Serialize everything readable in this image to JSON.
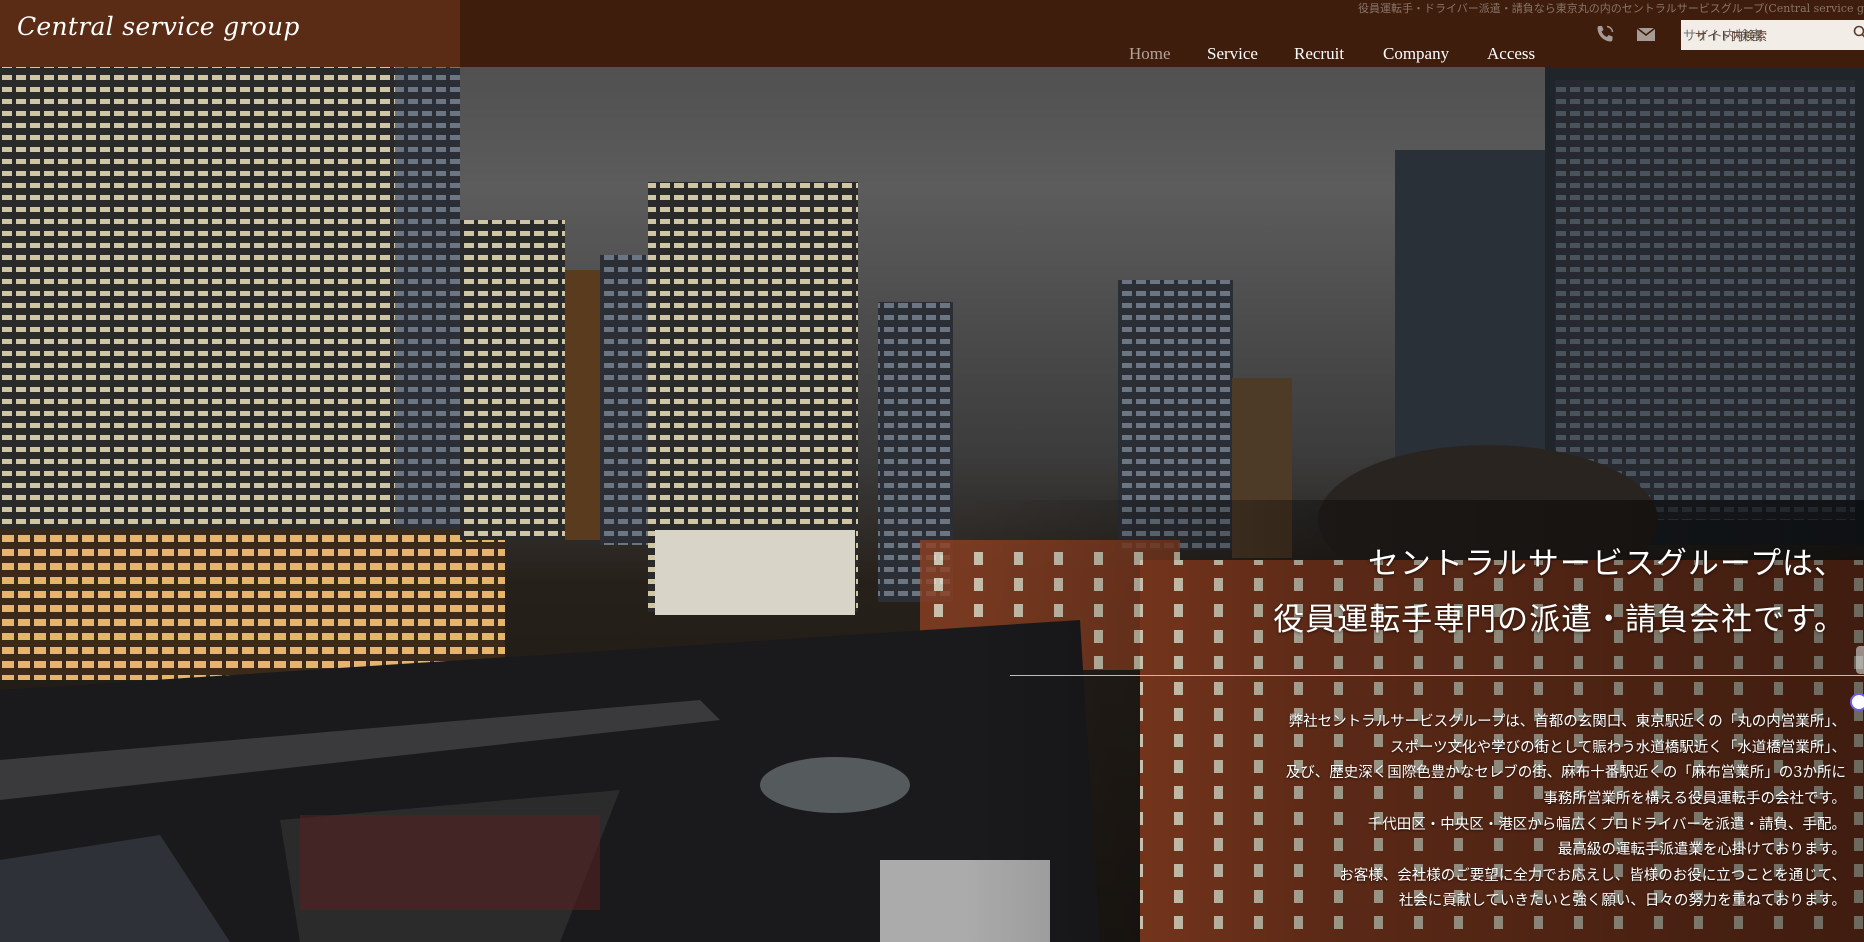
{
  "header": {
    "logo": "Central service group",
    "tagline": "役員運転手・ドライバー派遣・請負なら東京丸の内のセントラルサービスグループ(Central service g",
    "nav": [
      {
        "label": "Home",
        "active": true
      },
      {
        "label": "Service",
        "active": false
      },
      {
        "label": "Recruit",
        "active": false
      },
      {
        "label": "Company",
        "active": false
      },
      {
        "label": "Access",
        "active": false
      }
    ],
    "icons": [
      "phone-icon",
      "mail-icon"
    ],
    "search": {
      "placeholder": "サイト内検索"
    }
  },
  "hero": {
    "headline": [
      "セントラルサービスグループは、",
      "役員運転手専門の派遣・請負会社です。"
    ],
    "body": [
      "弊社セントラルサービスグループは、首都の玄関口、東京駅近くの「丸の内営業所」、",
      "スポーツ文化や学びの街として賑わう水道橋駅近く「水道橋営業所」、",
      "及び、歴史深く国際色豊かなセレブの街、麻布十番駅近くの「麻布営業所」の3か所に",
      "事務所営業所を構える役員運転手の会社です。",
      "千代田区・中央区・港区から幅広くプロドライバーを派遣・請負、手配。",
      "最高級の運転手派遣業を心掛けております。",
      "お客様、会社様のご要望に全力でお応えし、皆様のお役に立つことを通じて、",
      "社会に貢献していきたいと強く願い、日々の努力を重ねております。"
    ]
  },
  "colors": {
    "header_bg": "#3e1d0d",
    "logo_bg": "#5a2c15",
    "nav_active": "#b5a397",
    "search_bg": "#f3ede8"
  }
}
